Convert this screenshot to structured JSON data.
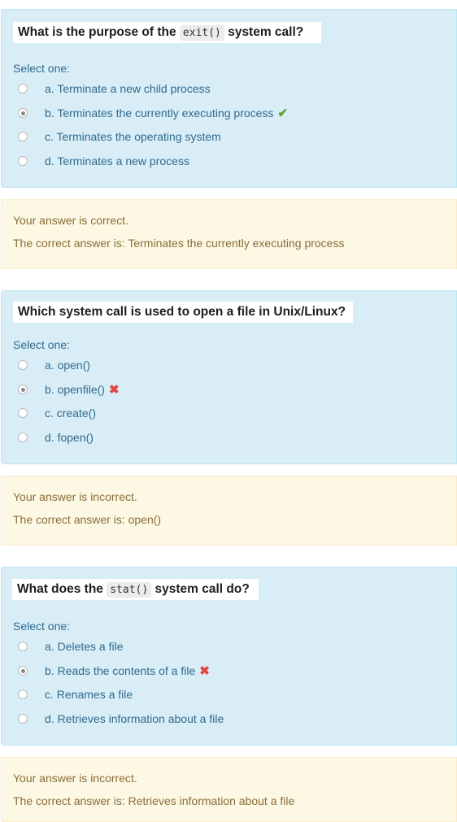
{
  "questions": [
    {
      "title_pre": "What is the purpose of the ",
      "title_code": "exit()",
      "title_post": " system call?",
      "select_label": "Select one:",
      "options": [
        {
          "label": "a. Terminate a new child process",
          "checked": false,
          "mark": ""
        },
        {
          "label": "b. Terminates the currently executing process",
          "checked": true,
          "mark": "✔"
        },
        {
          "label": "c. Terminates the operating system",
          "checked": false,
          "mark": ""
        },
        {
          "label": "d. Terminates a new process",
          "checked": false,
          "mark": ""
        }
      ],
      "feedback_status": "Your answer is correct.",
      "feedback_answer": "The correct answer is: Terminates the currently executing process"
    },
    {
      "title_pre": "Which system call is used to open a file in Unix/Linux?",
      "title_code": "",
      "title_post": "",
      "select_label": "Select one:",
      "options": [
        {
          "label": "a. open()",
          "checked": false,
          "mark": ""
        },
        {
          "label": "b. openfile()",
          "checked": true,
          "mark": "✖"
        },
        {
          "label": "c. create()",
          "checked": false,
          "mark": ""
        },
        {
          "label": "d. fopen()",
          "checked": false,
          "mark": ""
        }
      ],
      "feedback_status": "Your answer is incorrect.",
      "feedback_answer": "The correct answer is: open()"
    },
    {
      "title_pre": "What does the ",
      "title_code": "stat()",
      "title_post": " system call do?",
      "select_label": "Select one:",
      "options": [
        {
          "label": "a. Deletes a file",
          "checked": false,
          "mark": ""
        },
        {
          "label": "b. Reads the contents of a file",
          "checked": true,
          "mark": "✖"
        },
        {
          "label": "c. Renames a file",
          "checked": false,
          "mark": ""
        },
        {
          "label": "d. Retrieves information about a file",
          "checked": false,
          "mark": ""
        }
      ],
      "feedback_status": "Your answer is incorrect.",
      "feedback_answer": "The correct answer is: Retrieves information about a file"
    }
  ]
}
